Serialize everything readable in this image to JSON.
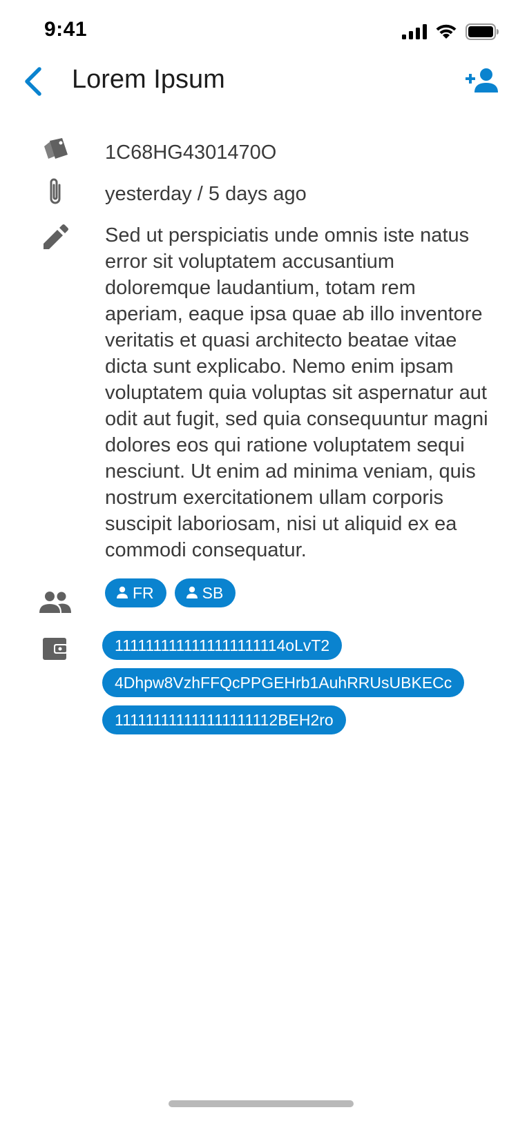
{
  "status_bar": {
    "time": "9:41",
    "icons": [
      "cellular-signal-icon",
      "wifi-icon",
      "battery-icon"
    ]
  },
  "nav": {
    "back_icon": "chevron-left-icon",
    "title": "Lorem Ipsum",
    "action_icon": "add-person-icon"
  },
  "details": {
    "id_icon": "tags-icon",
    "id": "1C68HG4301470O",
    "date_icon": "paperclip-icon",
    "date": "yesterday / 5 days ago",
    "description_icon": "pencil-icon",
    "description": "Sed ut perspiciatis unde omnis iste natus error sit voluptatem accusantium doloremque laudantium, totam rem aperiam, eaque ipsa quae ab illo inventore veritatis et quasi architecto beatae vitae dicta sunt explicabo. Nemo enim ipsam voluptatem quia voluptas sit aspernatur aut odit aut fugit, sed quia consequuntur magni dolores eos qui ratione voluptatem sequi nesciunt. Ut enim ad minima veniam, quis nostrum exercitationem ullam corporis suscipit laboriosam, nisi ut aliquid ex ea commodi consequatur.",
    "people_icon": "people-icon",
    "people": [
      {
        "label": "FR",
        "icon": "person-icon"
      },
      {
        "label": "SB",
        "icon": "person-icon"
      }
    ],
    "wallet_icon": "wallet-icon",
    "wallets": [
      "1111111111111111111114oLvT2",
      "4Dhpw8VzhFFQcPPGEHrb1AuhRRUsUBKECc",
      "111111111111111111112BEH2ro"
    ]
  },
  "colors": {
    "accent": "#0a83cf",
    "icon_gray": "#606060",
    "text": "#3a3a3a"
  }
}
